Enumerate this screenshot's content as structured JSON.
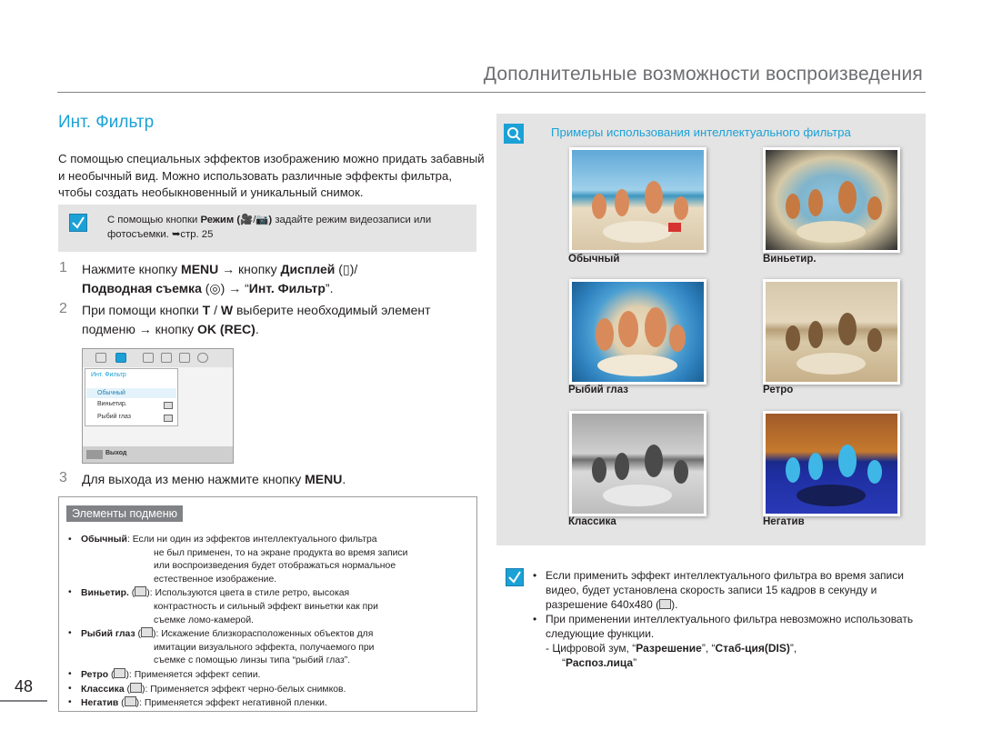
{
  "header": {
    "chapter_title": "Дополнительные возможности воспроизведения"
  },
  "section": {
    "title": "Инт. Фильтр",
    "intro": "С помощью специальных эффектов изображению можно придать забавный и необычный вид. Можно использовать различные эффекты фильтра, чтобы создать необыкновенный и уникальный снимок."
  },
  "note": {
    "pre": "С помощью кнопки ",
    "bold": "Режим (",
    "bold_close": ")",
    "post": " задайте режим видеозаписи или фотосъемки. ",
    "ref": "стр. 25"
  },
  "steps": [
    {
      "num": "1",
      "t1": "Нажмите кнопку ",
      "b1": "MENU",
      "t2": " → кнопку ",
      "b2": "Дисплей",
      "t3": " (",
      "t4": ")/ ",
      "b3": "Подводная съемка",
      "t5": " (",
      "t6": ") → “",
      "b4": "Инт. Фильтр",
      "t7": "”."
    },
    {
      "num": "2",
      "t1": "При помощи кнопки ",
      "b1": "T",
      "t2": " / ",
      "b2": "W",
      "t3": " выберите необходимый элемент подменю → кнопку ",
      "b3": "OK (REC)",
      "t4": "."
    },
    {
      "num": "3",
      "t1": "Для выхода из меню нажмите кнопку ",
      "b1": "MENU",
      "t2": "."
    }
  ],
  "menu_screen": {
    "panel_title": "Инт. Фильтр",
    "options": [
      "Обычный",
      "Виньетир.",
      "Рыбий глаз"
    ],
    "exit_label": "Выход"
  },
  "submenu": {
    "tab": "Элементы подменю",
    "items": [
      {
        "term": "Обычный",
        "lines": [
          ": Если ни один из эффектов интеллектуального фильтра",
          "не был применен, то на экране продукта во время записи",
          "или воспроизведения будет отображаться нормальное",
          "естественное изображение."
        ]
      },
      {
        "term": "Виньетир.",
        "lines": [
          "): Используются цвета в стиле ретро, высокая",
          "контрастность и сильный эффект виньетки как при",
          "съемке ломо-камерой."
        ]
      },
      {
        "term": "Рыбий глаз",
        "lines": [
          "): Искажение близкорасположенных объектов для",
          "имитации визуального эффекта, получаемого при",
          "съемке с помощью линзы типа “рыбий глаз”."
        ]
      },
      {
        "term": "Ретро",
        "lines": [
          "): Применяется эффект сепии."
        ]
      },
      {
        "term": "Классика",
        "lines": [
          "): Применяется эффект черно-белых снимков."
        ]
      },
      {
        "term": "Негатив",
        "lines": [
          "): Применяется эффект негативной пленки."
        ]
      }
    ]
  },
  "page_number": "48",
  "examples": {
    "title": "Примеры использования интеллектуального фильтра",
    "labels": [
      "Обычный",
      "Виньетир.",
      "Рыбий глаз",
      "Ретро",
      "Классика",
      "Негатив"
    ]
  },
  "note2": {
    "b1_text": "Если применить эффект интеллектуального фильтра во время записи видео, будет установлена скорость записи 15 кадров в секунду и разрешение 640x480 (",
    "b1_end": ").",
    "b2_text": "При применении интеллектуального фильтра невозможно использовать следующие функции.",
    "b2_sub_pre": "- Цифровой зум, “",
    "b2_sub_b1": "Разрешение",
    "b2_sub_m1": "”, “",
    "b2_sub_b2": "Стаб-ция(DIS)",
    "b2_sub_m2": "”,",
    "b2_sub_b3": "Распоз.лица",
    "b2_sub_end": "”"
  }
}
